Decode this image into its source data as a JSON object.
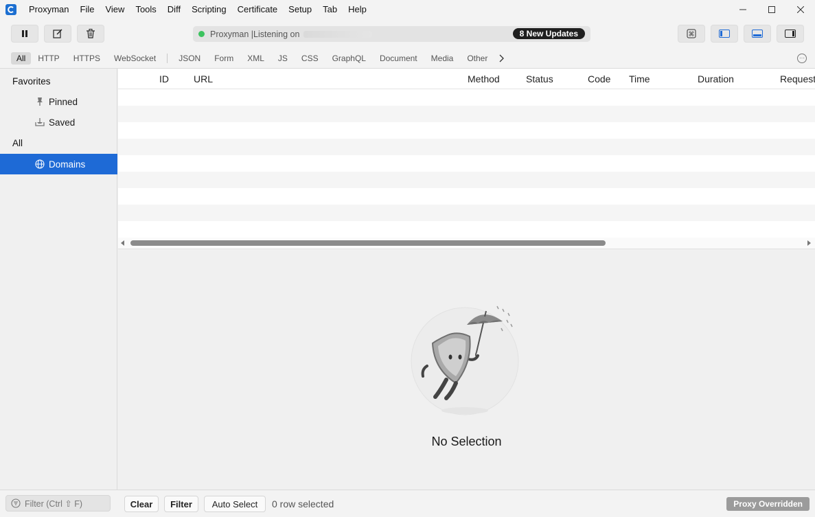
{
  "menubar": {
    "items": [
      "Proxyman",
      "File",
      "View",
      "Tools",
      "Diff",
      "Scripting",
      "Certificate",
      "Setup",
      "Tab",
      "Help"
    ]
  },
  "toolbar": {
    "status_text": "Proxyman |Listening on",
    "update_badge": "8 New Updates"
  },
  "filter_tabs": {
    "primary": [
      "All",
      "HTTP",
      "HTTPS",
      "WebSocket"
    ],
    "content": [
      "JSON",
      "Form",
      "XML",
      "JS",
      "CSS",
      "GraphQL",
      "Document",
      "Media",
      "Other"
    ],
    "active": "All"
  },
  "sidebar": {
    "favorites_label": "Favorites",
    "pinned_label": "Pinned",
    "saved_label": "Saved",
    "all_label": "All",
    "domains_label": "Domains"
  },
  "table": {
    "columns": [
      "ID",
      "URL",
      "Method",
      "Status",
      "Code",
      "Time",
      "Duration",
      "Request"
    ]
  },
  "detail": {
    "no_selection": "No Selection"
  },
  "bottombar": {
    "filter_placeholder": "Filter (Ctrl ⇧ F)",
    "clear_label": "Clear",
    "filter_label": "Filter",
    "auto_select_label": "Auto Select",
    "rows_selected": "0 row selected",
    "proxy_badge": "Proxy Overridden"
  },
  "colors": {
    "accent": "#1e6ad6",
    "status_dot": "#3cc35f",
    "badge_dark": "#1f1f1f"
  }
}
